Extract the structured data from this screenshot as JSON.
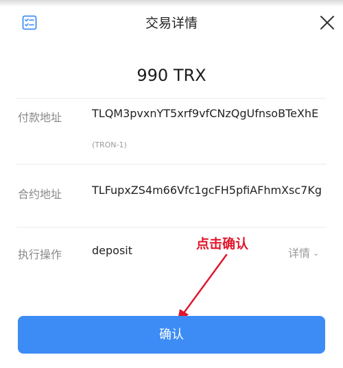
{
  "header": {
    "title": "交易详情"
  },
  "amount": "990 TRX",
  "rows": {
    "payer": {
      "label": "付款地址",
      "value": "TLQM3pvxnYT5xrf9vfCNzQgUfnsoBTeXhE",
      "chain": "(TRON-1)"
    },
    "contract": {
      "label": "合约地址",
      "value": "TLFupxZS4m66Vfc1gcFH5pfiAFhmXsc7Kg"
    },
    "action": {
      "label": "执行操作",
      "value": "deposit",
      "details_label": "详情"
    }
  },
  "annotation": "点击确认",
  "confirm_label": "确认",
  "colors": {
    "accent": "#3d8cf5",
    "annotation": "#e0162b"
  }
}
